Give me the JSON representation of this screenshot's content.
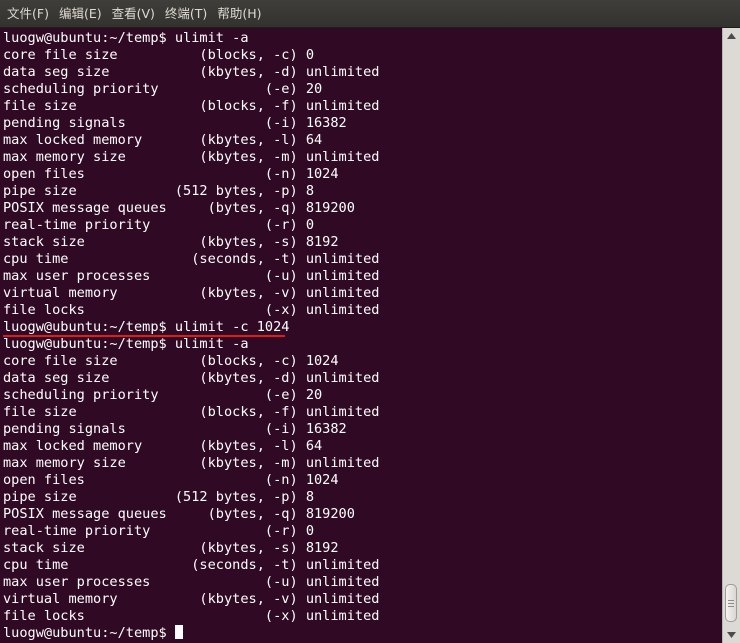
{
  "menu": [
    "文件(F)",
    "编辑(E)",
    "查看(V)",
    "终端(T)",
    "帮助(H)"
  ],
  "terminal": {
    "lines": [
      "luogw@ubuntu:~/temp$ ulimit -a",
      "core file size          (blocks, -c) 0",
      "data seg size           (kbytes, -d) unlimited",
      "scheduling priority             (-e) 20",
      "file size               (blocks, -f) unlimited",
      "pending signals                 (-i) 16382",
      "max locked memory       (kbytes, -l) 64",
      "max memory size         (kbytes, -m) unlimited",
      "open files                      (-n) 1024",
      "pipe size            (512 bytes, -p) 8",
      "POSIX message queues     (bytes, -q) 819200",
      "real-time priority              (-r) 0",
      "stack size              (kbytes, -s) 8192",
      "cpu time               (seconds, -t) unlimited",
      "max user processes              (-u) unlimited",
      "virtual memory          (kbytes, -v) unlimited",
      "file locks                      (-x) unlimited",
      "luogw@ubuntu:~/temp$ ulimit -c 1024",
      "luogw@ubuntu:~/temp$ ulimit -a",
      "core file size          (blocks, -c) 1024",
      "data seg size           (kbytes, -d) unlimited",
      "scheduling priority             (-e) 20",
      "file size               (blocks, -f) unlimited",
      "pending signals                 (-i) 16382",
      "max locked memory       (kbytes, -l) 64",
      "max memory size         (kbytes, -m) unlimited",
      "open files                      (-n) 1024",
      "pipe size            (512 bytes, -p) 8",
      "POSIX message queues     (bytes, -q) 819200",
      "real-time priority              (-r) 0",
      "stack size              (kbytes, -s) 8192",
      "cpu time               (seconds, -t) unlimited",
      "max user processes              (-u) unlimited",
      "virtual memory          (kbytes, -v) unlimited",
      "file locks                      (-x) unlimited",
      "luogw@ubuntu:~/temp$"
    ],
    "highlighted_line": 17,
    "highlight_color": "#e01b1b",
    "background_color": "#300a24",
    "text_color": "#ffffff"
  },
  "scroll": {
    "position": 1.0,
    "icons": {
      "up": "scroll-up-arrow-icon",
      "down": "scroll-down-arrow-icon"
    }
  }
}
